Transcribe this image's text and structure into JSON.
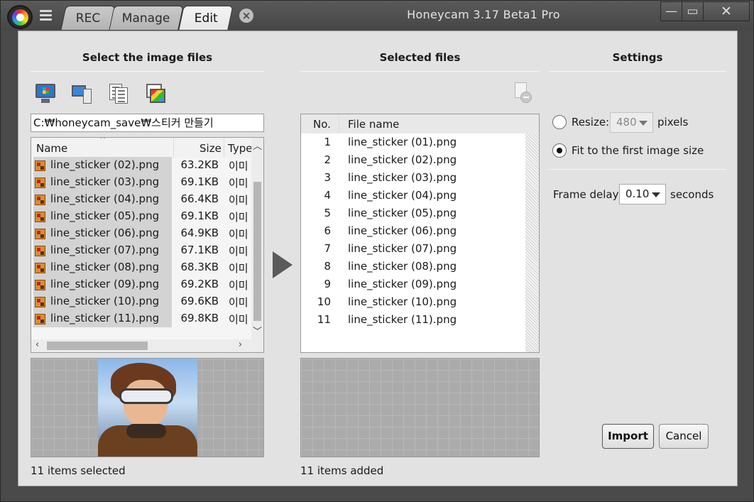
{
  "window": {
    "title": "Honeycam 3.17 Beta1 Pro",
    "controls": {
      "minimize": "—",
      "maximize": "▭",
      "close": "✕"
    }
  },
  "tabs": [
    {
      "label": "REC",
      "active": false
    },
    {
      "label": "Manage",
      "active": false
    },
    {
      "label": "Edit",
      "active": true
    }
  ],
  "tab_close": "×",
  "left_panel": {
    "title": "Select the image files",
    "toolbar_icons": [
      "desktop-icon",
      "computer-icon",
      "documents-icon",
      "pictures-icon"
    ],
    "path": "C:₩honeycam_save₩스티커 만들기",
    "columns": {
      "name": "Name",
      "size": "Size",
      "type": "Type"
    },
    "files": [
      {
        "name": "line_sticker (02).png",
        "size": "63.2KB",
        "type": "이미"
      },
      {
        "name": "line_sticker (03).png",
        "size": "69.1KB",
        "type": "이미"
      },
      {
        "name": "line_sticker (04).png",
        "size": "66.4KB",
        "type": "이미"
      },
      {
        "name": "line_sticker (05).png",
        "size": "69.1KB",
        "type": "이미"
      },
      {
        "name": "line_sticker (06).png",
        "size": "64.9KB",
        "type": "이미"
      },
      {
        "name": "line_sticker (07).png",
        "size": "67.1KB",
        "type": "이미"
      },
      {
        "name": "line_sticker (08).png",
        "size": "68.3KB",
        "type": "이미"
      },
      {
        "name": "line_sticker (09).png",
        "size": "69.2KB",
        "type": "이미"
      },
      {
        "name": "line_sticker (10).png",
        "size": "69.6KB",
        "type": "이미"
      },
      {
        "name": "line_sticker (11).png",
        "size": "69.8KB",
        "type": "이미"
      }
    ],
    "status": "11 items selected"
  },
  "middle_panel": {
    "title": "Selected files",
    "columns": {
      "no": "No.",
      "file_name": "File name"
    },
    "files": [
      {
        "no": "1",
        "name": "line_sticker (01).png"
      },
      {
        "no": "2",
        "name": "line_sticker (02).png"
      },
      {
        "no": "3",
        "name": "line_sticker (03).png"
      },
      {
        "no": "4",
        "name": "line_sticker (04).png"
      },
      {
        "no": "5",
        "name": "line_sticker (05).png"
      },
      {
        "no": "6",
        "name": "line_sticker (06).png"
      },
      {
        "no": "7",
        "name": "line_sticker (07).png"
      },
      {
        "no": "8",
        "name": "line_sticker (08).png"
      },
      {
        "no": "9",
        "name": "line_sticker (09).png"
      },
      {
        "no": "10",
        "name": "line_sticker (10).png"
      },
      {
        "no": "11",
        "name": "line_sticker (11).png"
      }
    ],
    "status": "11 items added"
  },
  "settings": {
    "title": "Settings",
    "resize_label": "Resize:",
    "resize_value": "480",
    "resize_unit": "pixels",
    "resize_checked": false,
    "fit_label": "Fit to the first image size",
    "fit_checked": true,
    "frame_delay_label": "Frame delay:",
    "frame_delay_value": "0.10",
    "frame_delay_unit": "seconds"
  },
  "buttons": {
    "import": "Import",
    "cancel": "Cancel"
  }
}
